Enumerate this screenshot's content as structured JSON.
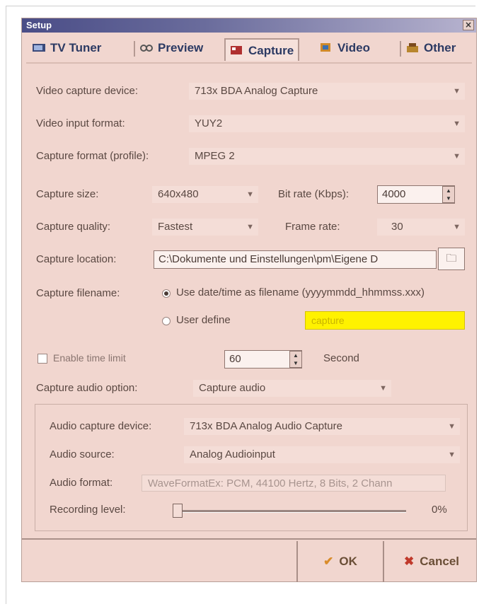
{
  "window": {
    "title": "Setup",
    "close": "×"
  },
  "tabs": [
    {
      "label": "TV Tuner",
      "icon": "tv-tuner-icon"
    },
    {
      "label": "Preview",
      "icon": "preview-icon"
    },
    {
      "label": "Capture",
      "icon": "capture-icon",
      "active": true
    },
    {
      "label": "Video",
      "icon": "video-icon"
    },
    {
      "label": "Other",
      "icon": "other-icon"
    }
  ],
  "capture": {
    "video_device_label": "Video capture device:",
    "video_device_value": "713x BDA Analog Capture",
    "input_format_label": "Video input format:",
    "input_format_value": "YUY2",
    "profile_label": "Capture format (profile):",
    "profile_value": "MPEG 2",
    "size_label": "Capture size:",
    "size_value": "640x480",
    "bitrate_label": "Bit rate (Kbps):",
    "bitrate_value": "4000",
    "quality_label": "Capture quality:",
    "quality_value": "Fastest",
    "framerate_label": "Frame rate:",
    "framerate_value": "30",
    "location_label": "Capture location:",
    "location_value": "C:\\Dokumente und Einstellungen\\pm\\Eigene D",
    "filename_label": "Capture filename:",
    "filename_option_date": "Use date/time as filename (yyyymmdd_hhmmss.xxx)",
    "filename_option_user": "User define",
    "user_filename_value": "capture",
    "timelimit_label": "Enable time limit",
    "timelimit_value": "60",
    "timelimit_unit": "Second",
    "audio_option_label": "Capture audio option:",
    "audio_option_value": "Capture audio"
  },
  "audio": {
    "device_label": "Audio capture device:",
    "device_value": "713x BDA Analog Audio Capture",
    "source_label": "Audio source:",
    "source_value": "Analog Audioinput",
    "format_label": "Audio format:",
    "format_value": "WaveFormatEx: PCM, 44100 Hertz, 8 Bits, 2 Chann",
    "level_label": "Recording level:",
    "level_value": "0%",
    "level_fraction": 0.0
  },
  "buttons": {
    "ok": "OK",
    "cancel": "Cancel"
  },
  "colors": {
    "dialog_bg": "#f1d6cf",
    "highlight_yellow": "#fff200",
    "title_bar": "#4a4d87",
    "ok_icon": "#d98c2a",
    "cancel_icon": "#c0392b"
  }
}
